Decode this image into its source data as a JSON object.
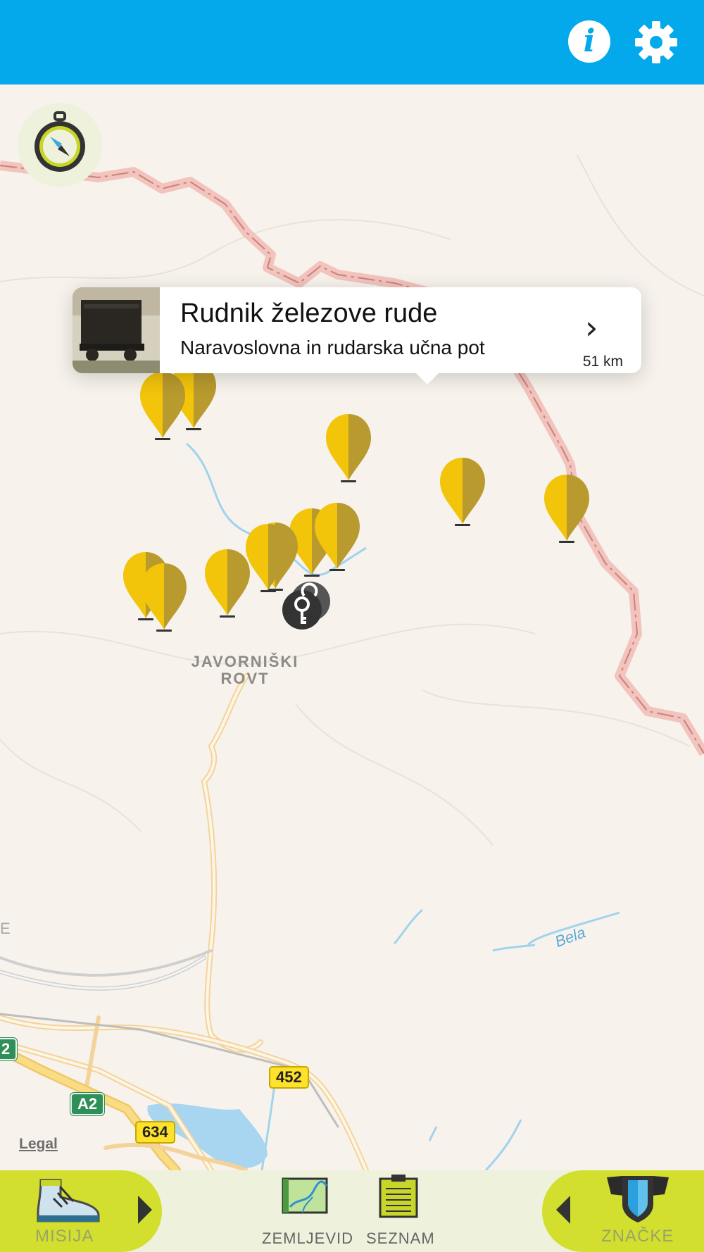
{
  "header": {
    "info_icon": "info-icon",
    "settings_icon": "gear-icon",
    "info_glyph": "i",
    "accent": "#03a9ea"
  },
  "map": {
    "place_label": "JAVORNIŠKI\nROVT",
    "river_label": "Bela",
    "legal_link": "Legal",
    "road_shields": [
      "452",
      "634",
      "A2",
      "2"
    ],
    "edge_glyph": "E"
  },
  "callout": {
    "title": "Rudnik železove rude",
    "subtitle": "Naravoslovna in rudarska učna pot",
    "distance": "51 km",
    "chevron": "›"
  },
  "bottom_bar": {
    "mission_label": "MISIJA",
    "map_label": "ZEMLJEVID",
    "list_label": "SEZNAM",
    "badges_label": "ZNAČKE",
    "accent": "#d3df2e"
  },
  "pin_color": "#f2c40a"
}
